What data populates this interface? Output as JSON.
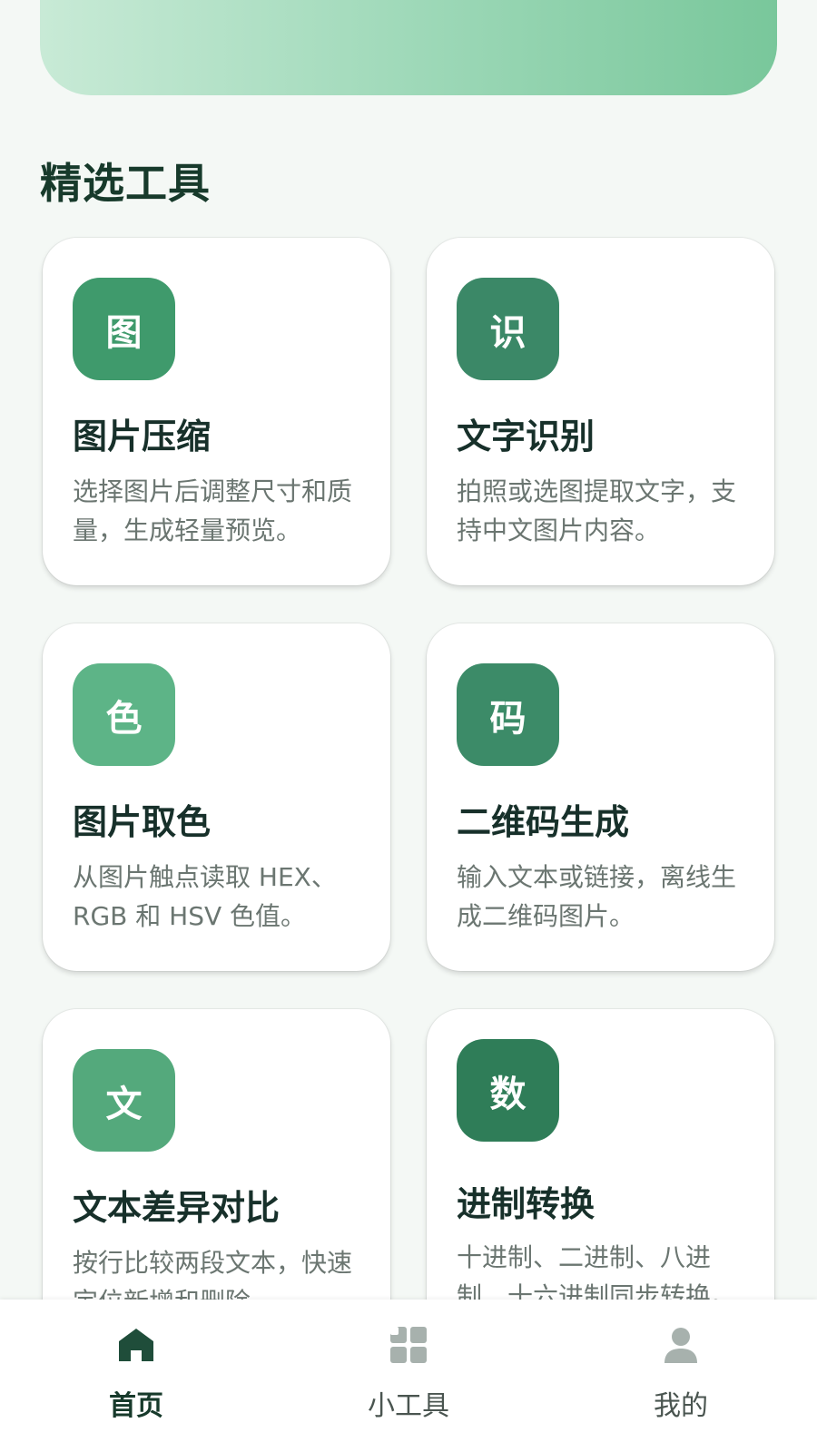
{
  "section": {
    "title": "精选工具"
  },
  "tools": [
    {
      "icon_text": "图",
      "icon_color": "#3f9a6c",
      "title": "图片压缩",
      "desc": "选择图片后调整尺寸和质量，生成轻量预览。"
    },
    {
      "icon_text": "识",
      "icon_color": "#3b8867",
      "title": "文字识别",
      "desc": "拍照或选图提取文字，支持中文图片内容。"
    },
    {
      "icon_text": "色",
      "icon_color": "#5db487",
      "title": "图片取色",
      "desc": "从图片触点读取 HEX、RGB 和 HSV 色值。"
    },
    {
      "icon_text": "码",
      "icon_color": "#3c8b68",
      "title": "二维码生成",
      "desc": "输入文本或链接，离线生成二维码图片。"
    },
    {
      "icon_text": "文",
      "icon_color": "#54a97c",
      "title": "文本差异对比",
      "desc": "按行比较两段文本，快速定位新增和删除。"
    },
    {
      "icon_text": "数",
      "icon_color": "#2f7d58",
      "title": "进制转换",
      "desc": "十进制、二进制、八进制、十六进制同步转换。"
    }
  ],
  "nav": {
    "home": "首页",
    "tools": "小工具",
    "me": "我的",
    "active_color": "#1f4d3a",
    "inactive_color": "#a7b1ad"
  }
}
